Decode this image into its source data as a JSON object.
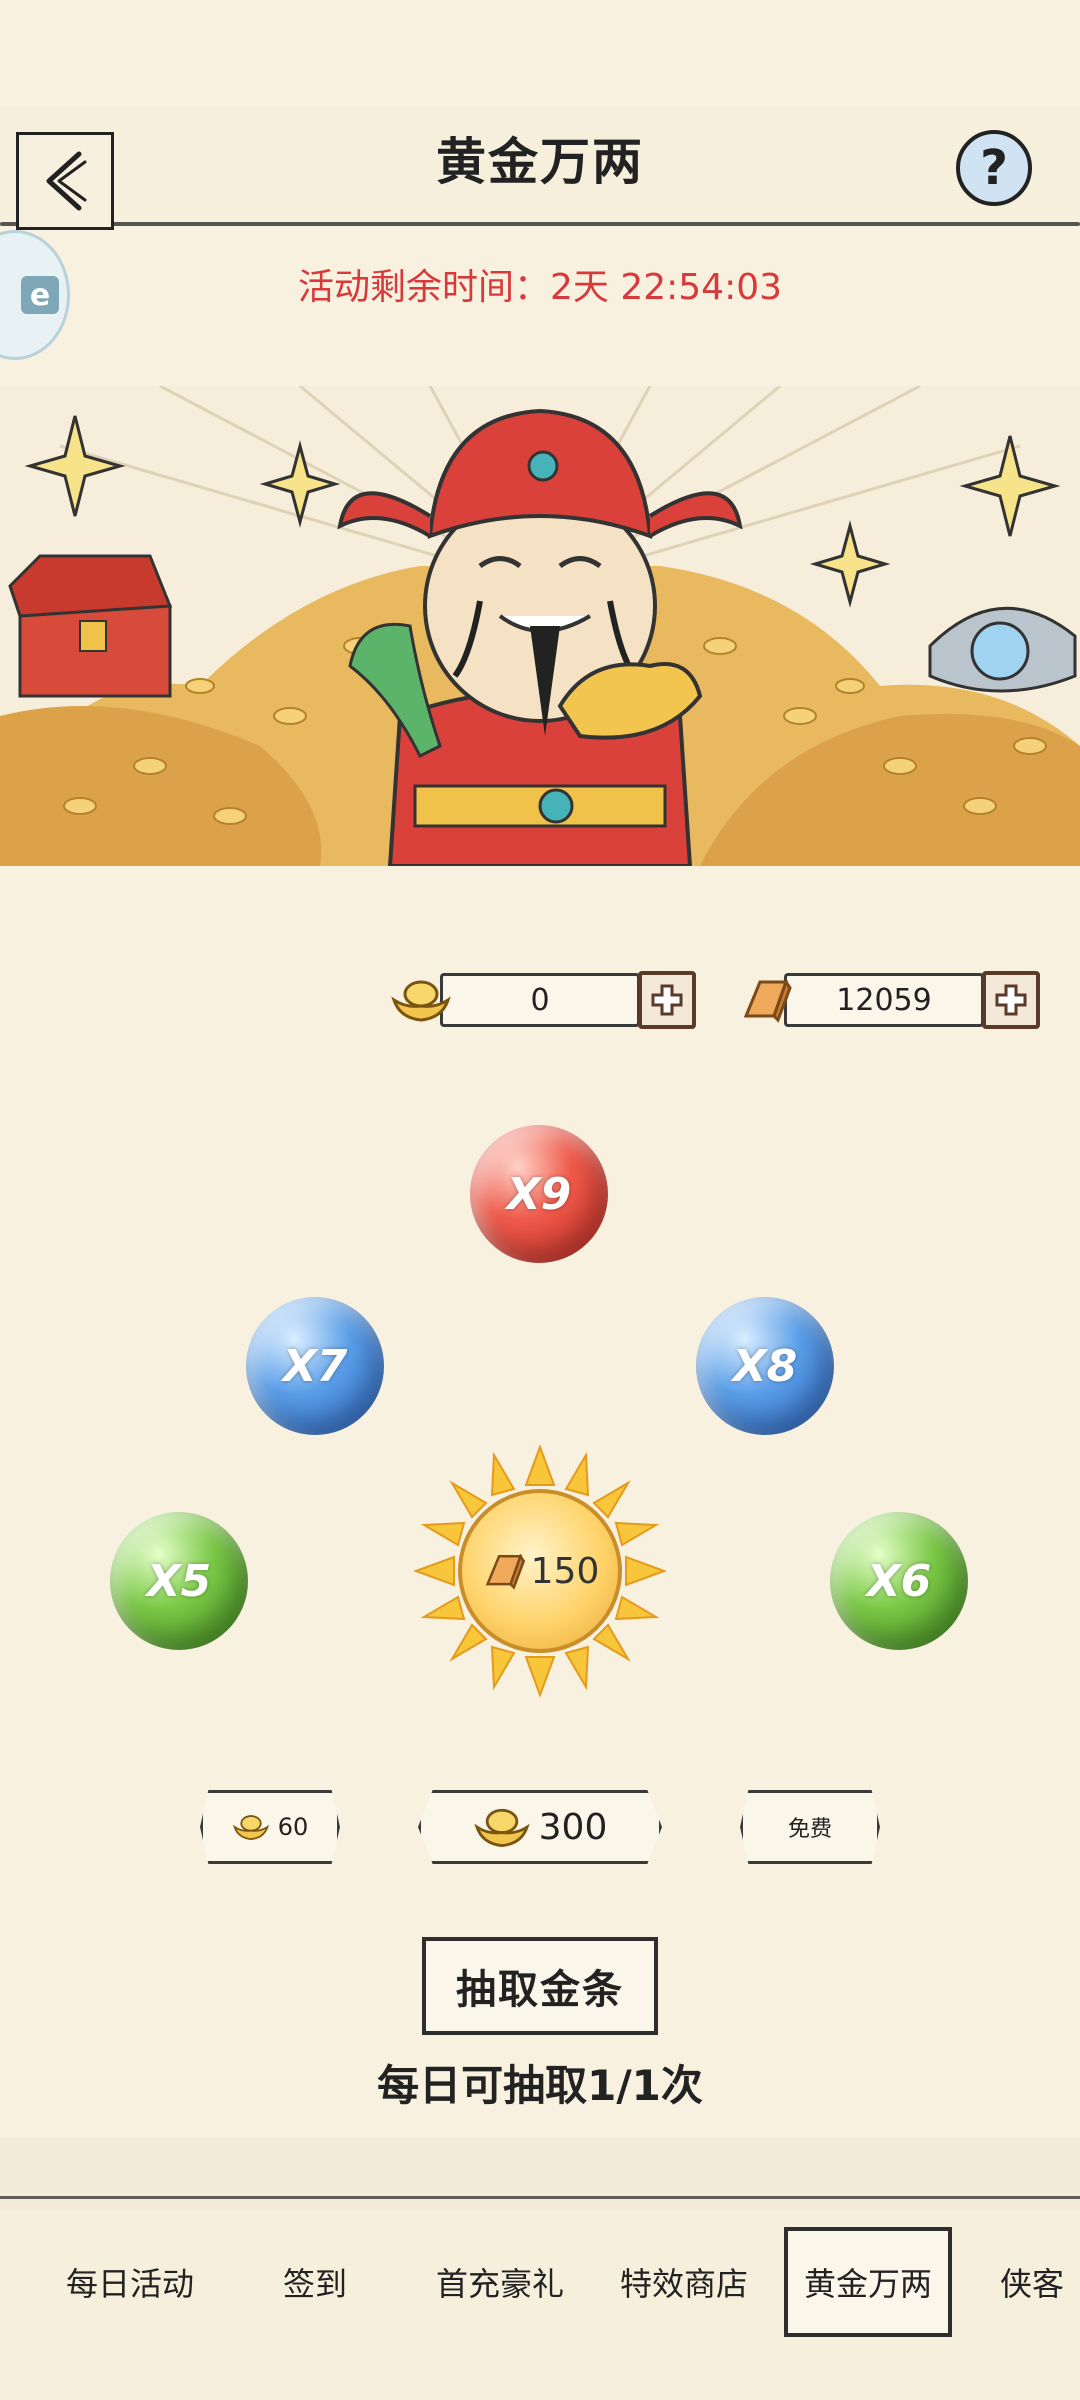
{
  "header": {
    "title": "黄金万两",
    "help_symbol": "?"
  },
  "side_badge": {
    "text": "e"
  },
  "timer": {
    "text": "活动剩余时间：2天 22:54:03"
  },
  "currencies": [
    {
      "icon": "gold-ingot-icon",
      "value": "0"
    },
    {
      "icon": "gold-bar-icon",
      "value": "12059"
    }
  ],
  "orbs": [
    {
      "label": "X9",
      "color": "red"
    },
    {
      "label": "X7",
      "color": "blue"
    },
    {
      "label": "X8",
      "color": "blue"
    },
    {
      "label": "X5",
      "color": "green"
    },
    {
      "label": "X6",
      "color": "green"
    }
  ],
  "center": {
    "value": "150"
  },
  "tickets": [
    {
      "value": "60"
    },
    {
      "value": "300"
    },
    {
      "label": "免费"
    }
  ],
  "draw_button": {
    "label": "抽取金条"
  },
  "daily_text": "每日可抽取1/1次",
  "tabs": [
    {
      "label": "每日活动",
      "active": false
    },
    {
      "label": "签到",
      "active": false
    },
    {
      "label": "首充豪礼",
      "active": false
    },
    {
      "label": "特效商店",
      "active": false
    },
    {
      "label": "黄金万两",
      "active": true
    },
    {
      "label": "侠客",
      "active": false
    }
  ],
  "colors": {
    "background": "#f8f1e0",
    "timer": "#d8393a",
    "border": "#2e2e2e"
  }
}
